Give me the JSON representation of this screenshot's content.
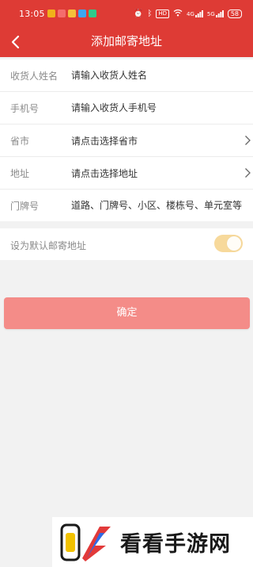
{
  "status_bar": {
    "time": "13:05",
    "app_colors": [
      "#f0b21a",
      "#f46d6d",
      "#f5c13a",
      "#3ca7f2",
      "#2fc98b"
    ],
    "network_label": "HD",
    "signal_1": "4G",
    "signal_2": "5G",
    "battery": "58"
  },
  "nav": {
    "title": "添加邮寄地址",
    "back_icon": "chevron-left-icon"
  },
  "form": {
    "name": {
      "label": "收货人姓名",
      "placeholder": "请输入收货人姓名"
    },
    "phone": {
      "label": "手机号",
      "placeholder": "请输入收货人手机号"
    },
    "province": {
      "label": "省市",
      "value": "请点击选择省市"
    },
    "address": {
      "label": "地址",
      "value": "请点击选择地址"
    },
    "door": {
      "label": "门牌号",
      "placeholder": "道路、门牌号、小区、楼栋号、单元室等"
    }
  },
  "default_address": {
    "label": "设为默认邮寄地址",
    "enabled": true
  },
  "confirm_label": "确定",
  "watermark_text": "看看手游网",
  "colors": {
    "brand_red": "#de3b35",
    "button_pink": "#f48c88",
    "toggle_on": "#f7d99b",
    "page_bg": "#f2f2f2"
  }
}
